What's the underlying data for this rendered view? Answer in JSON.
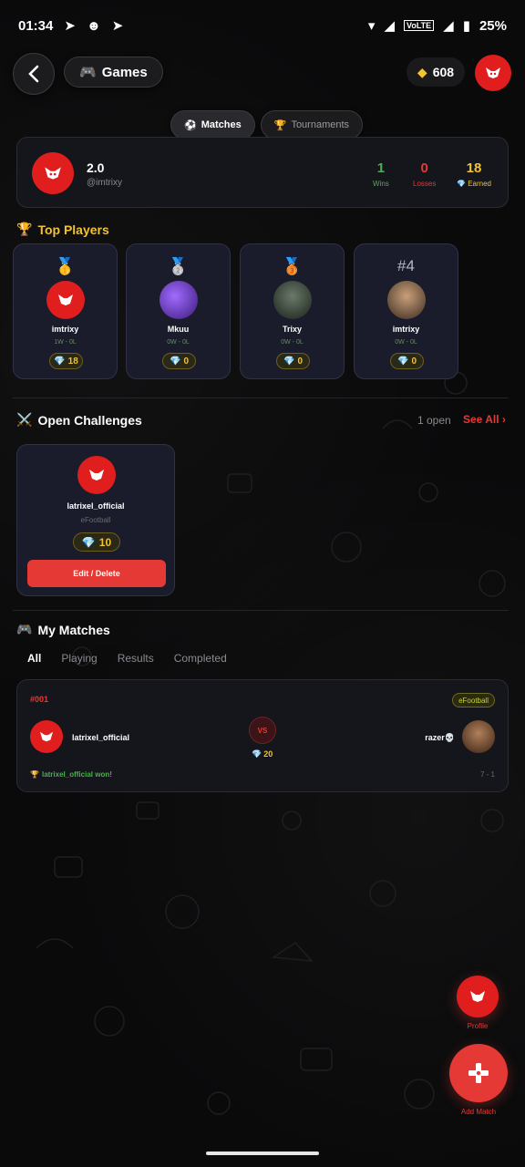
{
  "status_bar": {
    "time": "01:34",
    "battery": "25%"
  },
  "header": {
    "title": "Games",
    "gem_balance": "608"
  },
  "tabs": [
    {
      "icon": "soccer-ball-icon",
      "label": "Matches",
      "active": true
    },
    {
      "icon": "trophy-icon",
      "label": "Tournaments",
      "active": false
    }
  ],
  "profile": {
    "name": "2.0",
    "handle": "@imtrixy",
    "stats": [
      {
        "value": "1",
        "label": "Wins",
        "color": "#4caf50"
      },
      {
        "value": "0",
        "label": "Losses",
        "color": "#e53935"
      },
      {
        "value": "18",
        "label": "Earned",
        "color": "#f1c232"
      }
    ]
  },
  "top_players": {
    "title": "Top Players",
    "items": [
      {
        "rank": "gold-medal",
        "name": "imtrixy",
        "record": "1W - 0L",
        "gems": "18"
      },
      {
        "rank": "silver-medal",
        "name": "Mkuu",
        "record": "0W - 0L",
        "gems": "0"
      },
      {
        "rank": "bronze-medal",
        "name": "Trixy",
        "record": "0W - 0L",
        "gems": "0"
      },
      {
        "rank": "#4",
        "name": "imtrixy",
        "record": "0W - 0L",
        "gems": "0"
      }
    ]
  },
  "open_challenges": {
    "title": "Open Challenges",
    "count_text": "1 open",
    "see_all": "See All ›",
    "items": [
      {
        "user": "latrixel_official",
        "game": "eFootball",
        "stake": "10",
        "action": "Edit / Delete"
      }
    ]
  },
  "my_matches": {
    "title": "My Matches",
    "filters": [
      "All",
      "Playing",
      "Results",
      "Completed"
    ],
    "active_filter": "All",
    "items": [
      {
        "id": "#001",
        "game": "eFootball",
        "player1": "latrixel_official",
        "player2": "razer💀",
        "vs": "VS",
        "stake": "20",
        "result": "latrixel_official won!",
        "score": "7 - 1"
      }
    ]
  },
  "fab": {
    "profile_label": "Profile",
    "add_label": "Add Match"
  },
  "colors": {
    "accent": "#e53935",
    "gold": "#f1c232",
    "green": "#4caf50"
  }
}
